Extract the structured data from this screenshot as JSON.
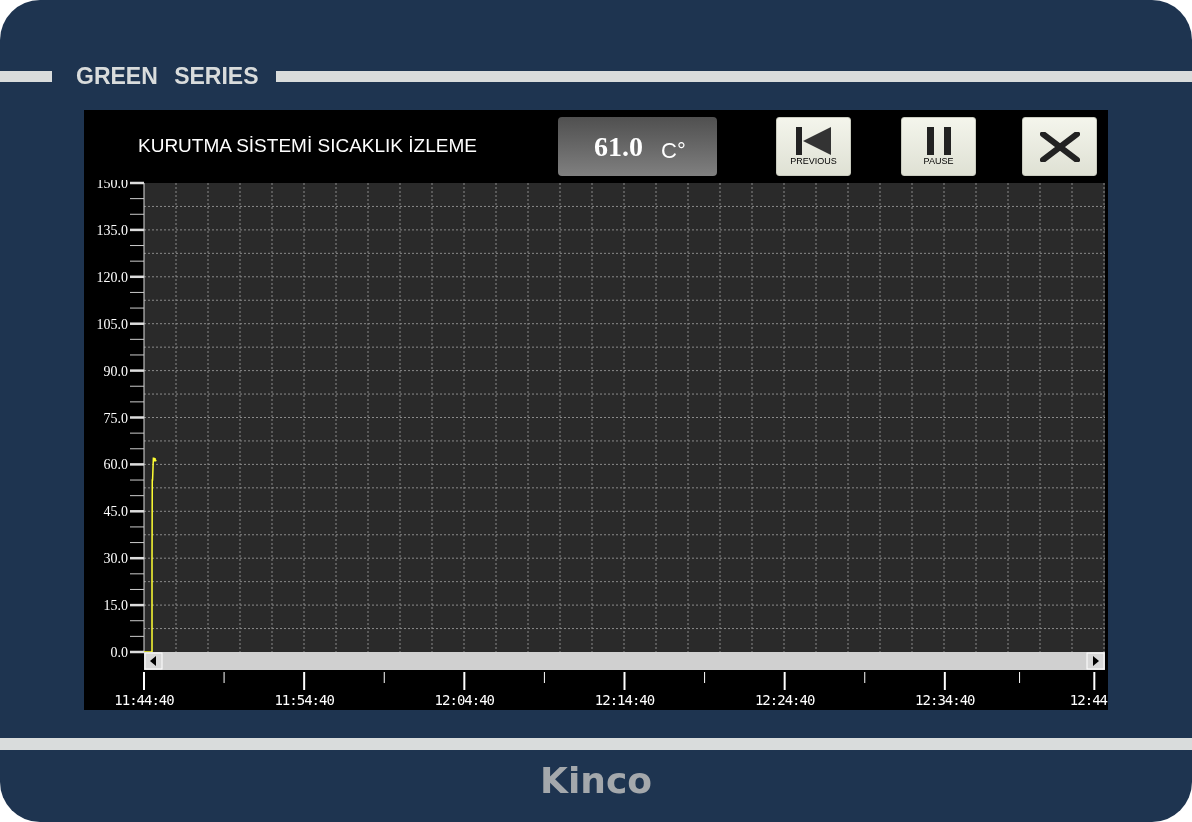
{
  "bezel": {
    "series_label": "GREEN SERIES",
    "brand": "Kinco"
  },
  "screen": {
    "title": "KURUTMA SİSTEMİ SICAKLIK İZLEME",
    "reading": {
      "value": "61.0",
      "unit": "C°"
    },
    "buttons": [
      {
        "kind": "previous",
        "label": "PREVIOUS"
      },
      {
        "kind": "pause",
        "label": "PAUSE"
      },
      {
        "kind": "close"
      }
    ],
    "chart_data": {
      "type": "line",
      "grid": true,
      "x": [
        42280,
        42310,
        42310,
        42311,
        42312,
        42313,
        42315,
        42317,
        42319,
        42321,
        42323,
        42325
      ],
      "series": [
        {
          "color": "#ffff33",
          "values": [
            0,
            0,
            28,
            55,
            55,
            57,
            62,
            62,
            61,
            62,
            61,
            61.5
          ]
        }
      ],
      "xlim": [
        42280,
        45880
      ],
      "ylim": [
        0,
        150
      ],
      "xticks": [
        {
          "value": 42280,
          "label": "11:44:40"
        },
        {
          "value": 42880,
          "label": "11:54:40"
        },
        {
          "value": 43480,
          "label": "12:04:40"
        },
        {
          "value": 44080,
          "label": "12:14:40"
        },
        {
          "value": 44680,
          "label": "12:24:40"
        },
        {
          "value": 45280,
          "label": "12:34:40"
        },
        {
          "value": 45840,
          "label": "12:44"
        }
      ],
      "yticks": [
        {
          "value": 0,
          "label": "0.0"
        },
        {
          "value": 15,
          "label": "15.0"
        },
        {
          "value": 30,
          "label": "30.0"
        },
        {
          "value": 45,
          "label": "45.0"
        },
        {
          "value": 60,
          "label": "60.0"
        },
        {
          "value": 75,
          "label": "75.0"
        },
        {
          "value": 90,
          "label": "90.0"
        },
        {
          "value": 105,
          "label": "105.0"
        },
        {
          "value": 120,
          "label": "120.0"
        },
        {
          "value": 135,
          "label": "135.0"
        },
        {
          "value": 150,
          "label": "150.0"
        }
      ]
    }
  }
}
